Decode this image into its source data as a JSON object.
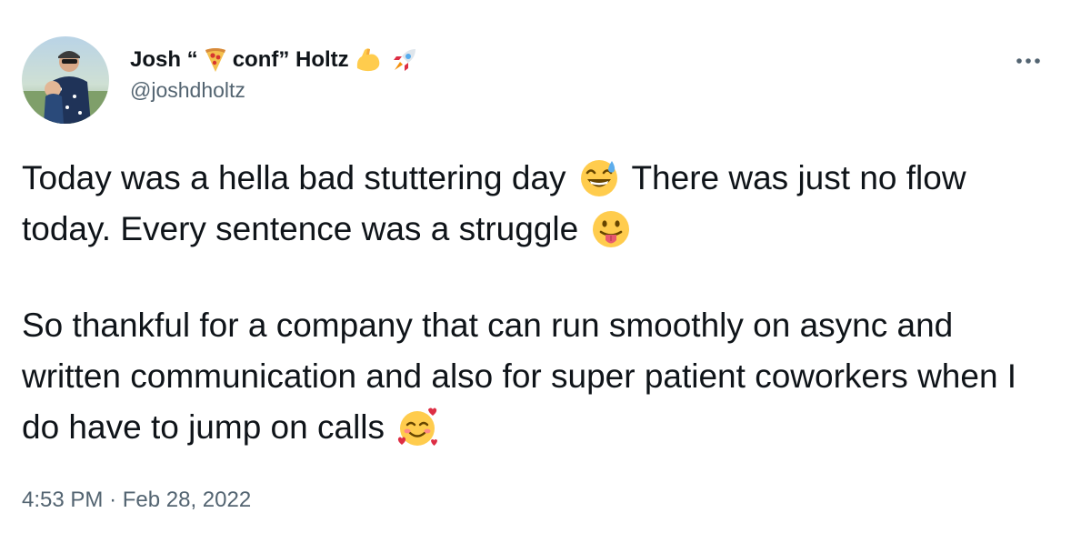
{
  "author": {
    "name_part1": "Josh “",
    "name_part2": "conf” Holtz",
    "handle": "@joshdholtz",
    "name_emojis": [
      "pizza-icon",
      "flexed-biceps-icon",
      "rocket-icon"
    ]
  },
  "tweet": {
    "line_a1": "Today was a hella bad stuttering day",
    "line_a2": "There was just no flow today. Every sentence was a struggle",
    "line_b": "So thankful for a company that can run smoothly on async and written communication and also for super patient coworkers when I do have to jump on calls",
    "emojis": [
      "grinning-sweat-icon",
      "tongue-out-icon",
      "smiling-hearts-icon"
    ]
  },
  "meta": {
    "time": "4:53 PM",
    "separator": "·",
    "date": "Feb 28, 2022"
  },
  "colors": {
    "text": "#0f1419",
    "secondary": "#536471",
    "emoji_yellow": "#ffcc4d"
  }
}
